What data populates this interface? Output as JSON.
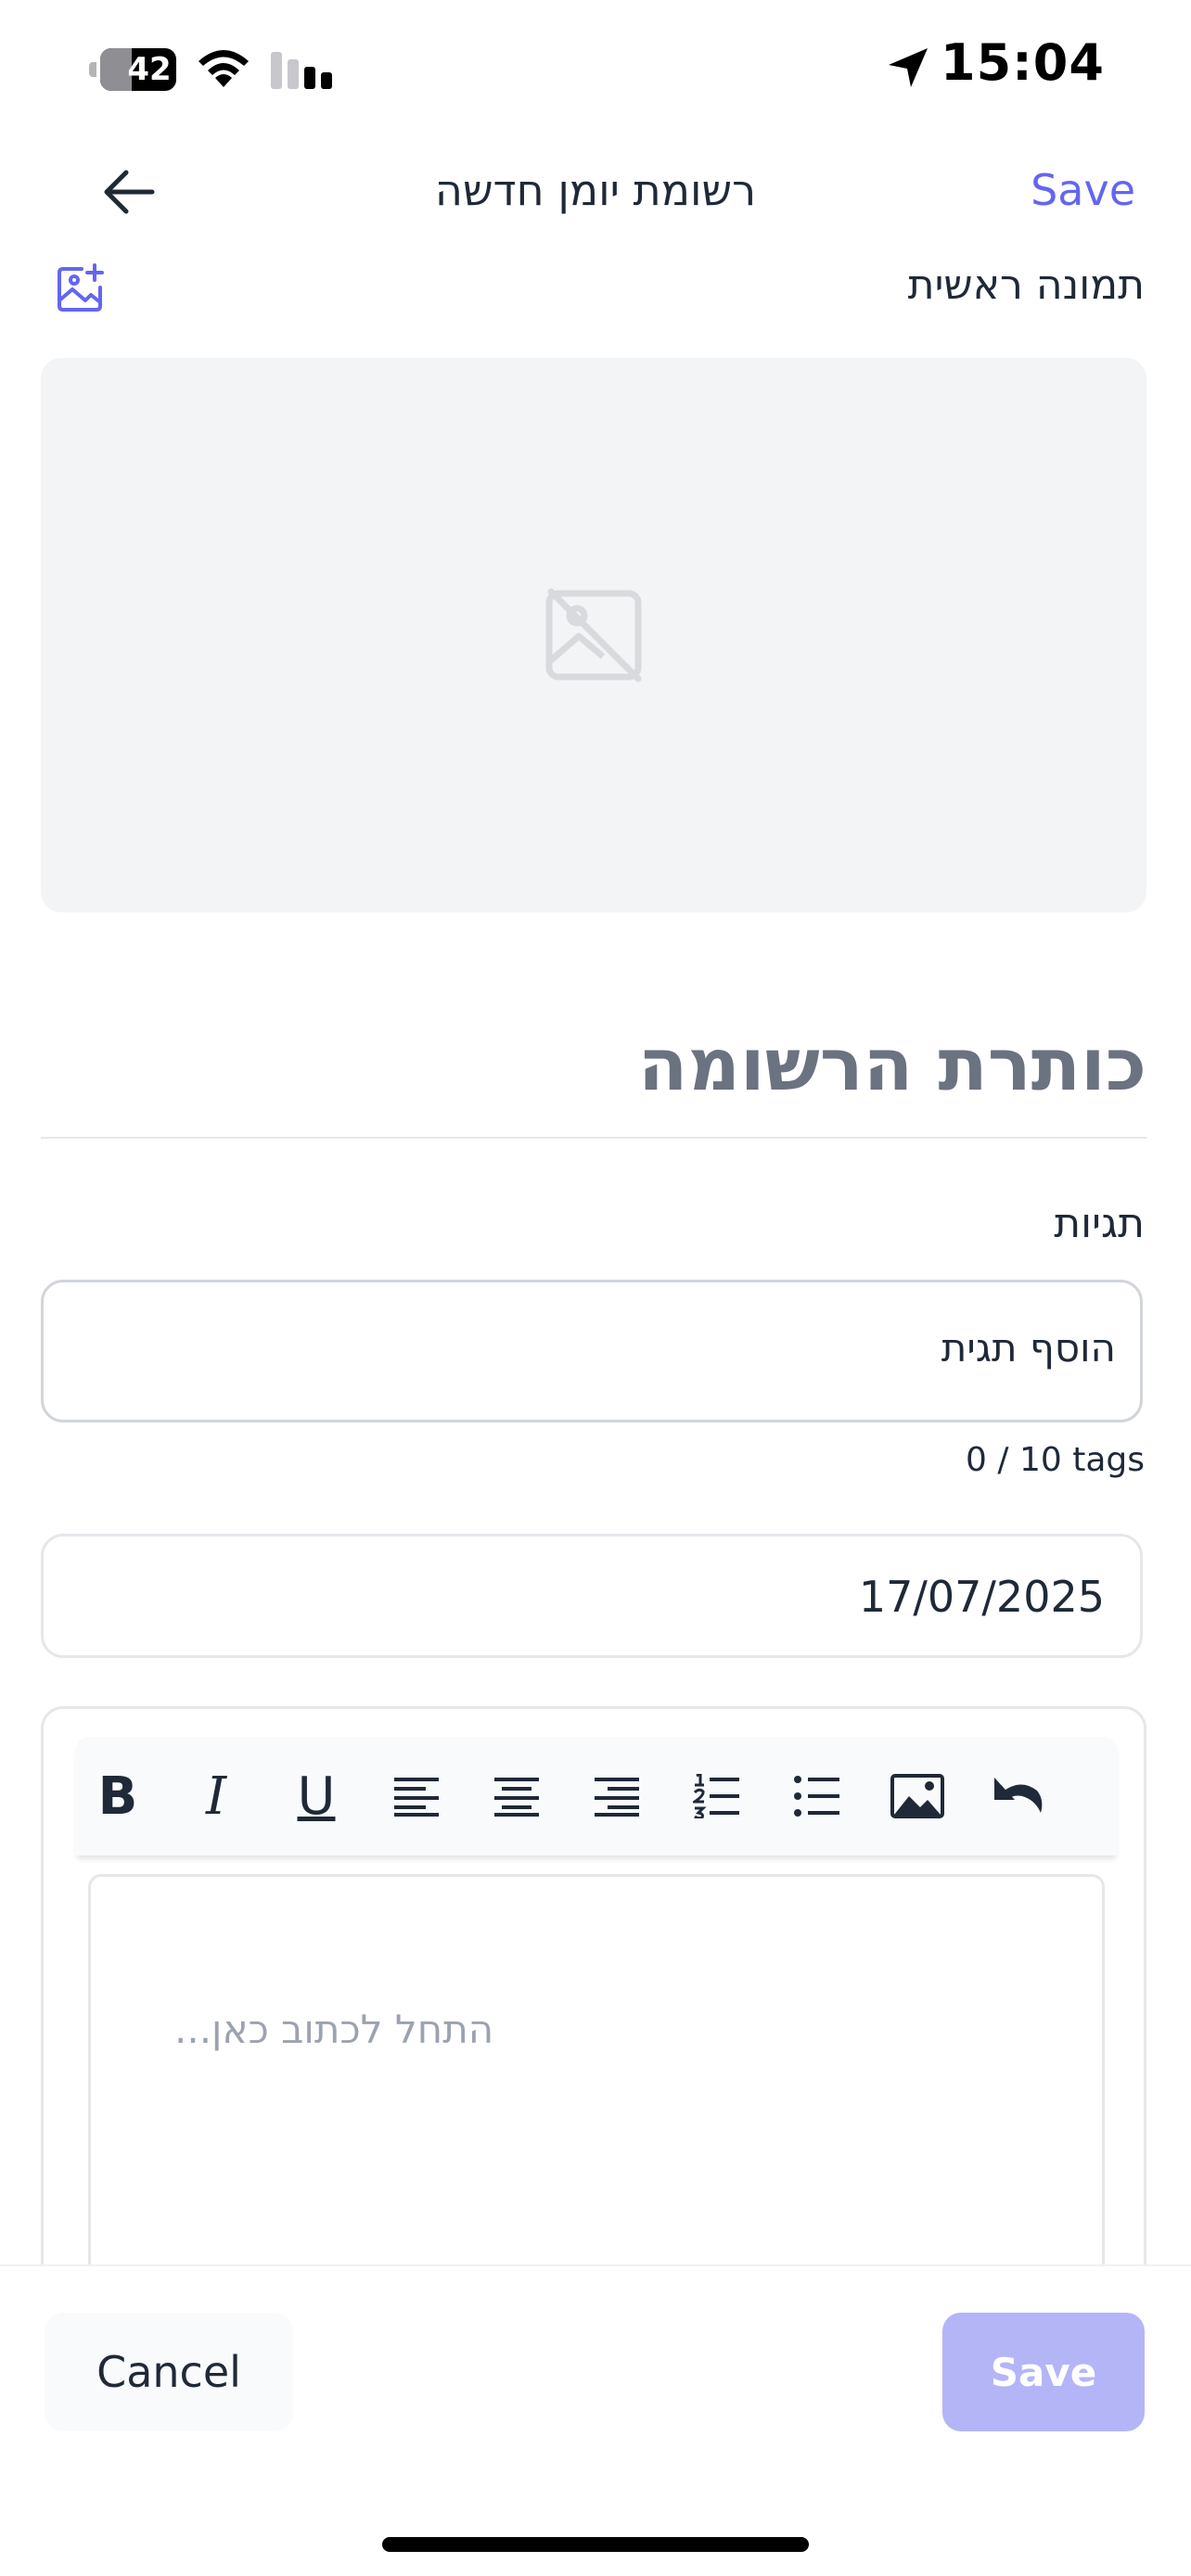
{
  "status_bar": {
    "battery_level": "42",
    "battery_fraction": 0.42,
    "time": "15:04",
    "icons": [
      "battery-icon",
      "wifi-icon",
      "cellular-signal-icon",
      "location-arrow-icon"
    ]
  },
  "header": {
    "back_icon": "arrow-left-icon",
    "title": "רשומת יומן חדשה",
    "save_label": "Save"
  },
  "main_image": {
    "label": "תמונה ראשית",
    "add_icon": "add-image-icon",
    "placeholder_icon": "image-off-icon"
  },
  "title_field": {
    "placeholder": "כותרת הרשומה",
    "value": ""
  },
  "tags": {
    "label": "תגיות",
    "input_placeholder": "הוסף תגית",
    "count_text": "0 / 10 tags"
  },
  "date": {
    "value": "17/07/2025"
  },
  "editor": {
    "toolbar": {
      "bold": "B",
      "italic": "I",
      "underline": "U",
      "icons": [
        "align-left-icon",
        "align-center-icon",
        "align-right-icon",
        "ordered-list-icon",
        "bullet-list-icon",
        "insert-image-icon",
        "undo-icon"
      ]
    },
    "placeholder": "התחל לכתוב כאן..."
  },
  "footer": {
    "cancel_label": "Cancel",
    "save_label": "Save"
  },
  "colors": {
    "accent": "#6366f1",
    "save_disabled": "#b4b5f7",
    "placeholder_bg": "#f3f4f6",
    "border": "#d1d5db",
    "text": "#1f2937"
  }
}
